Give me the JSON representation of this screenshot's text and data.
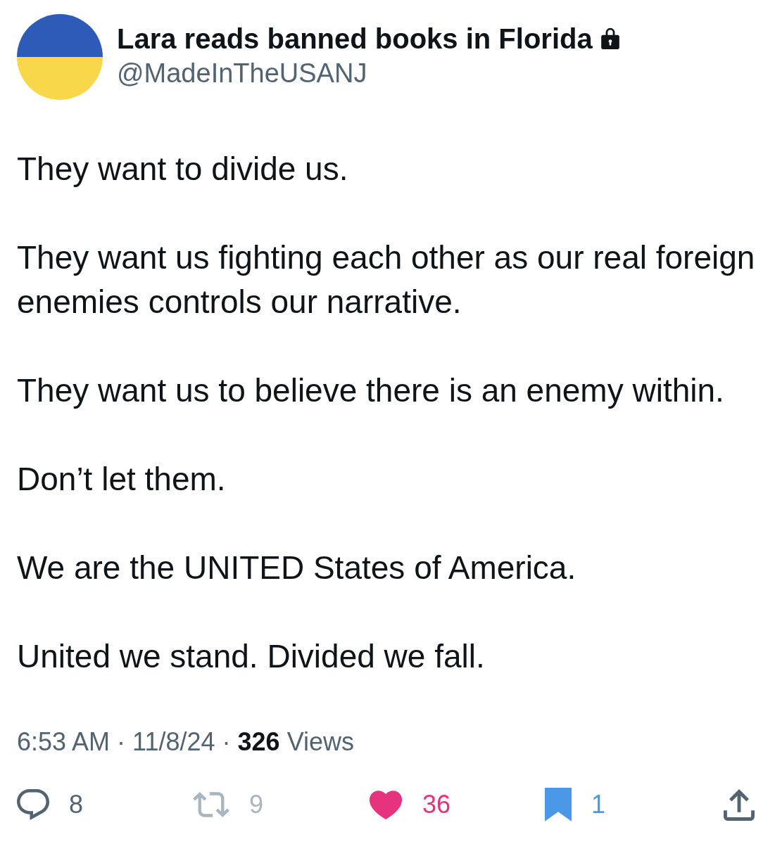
{
  "author": {
    "name": "Lara reads banned books in Florida",
    "protected": true,
    "handle": "@MadeInTheUSANJ"
  },
  "paragraphs": [
    "They want to divide us.",
    "They want us fighting each other as our real foreign enemies controls our narrative.",
    "They want us to believe there is an enemy within.",
    "Don’t let them.",
    "We are the UNITED States of America.",
    "United we stand. Divided we fall."
  ],
  "meta": [
    {
      "kind": "time",
      "text": "6:53 AM"
    },
    {
      "kind": "dot",
      "text": "·"
    },
    {
      "kind": "date",
      "text": "11/8/24"
    },
    {
      "kind": "dot",
      "text": "·"
    },
    {
      "kind": "views_count",
      "text": "326"
    },
    {
      "kind": "views_label",
      "text": "Views"
    }
  ],
  "actions": [
    {
      "kind": "reply",
      "count": "8",
      "on": false,
      "disabled": false
    },
    {
      "kind": "repost",
      "count": "9",
      "on": false,
      "disabled": true
    },
    {
      "kind": "like",
      "count": "36",
      "on": true,
      "disabled": false
    },
    {
      "kind": "bookmark",
      "count": "1",
      "on": true,
      "disabled": false
    },
    {
      "kind": "share",
      "on": false,
      "disabled": false
    }
  ]
}
